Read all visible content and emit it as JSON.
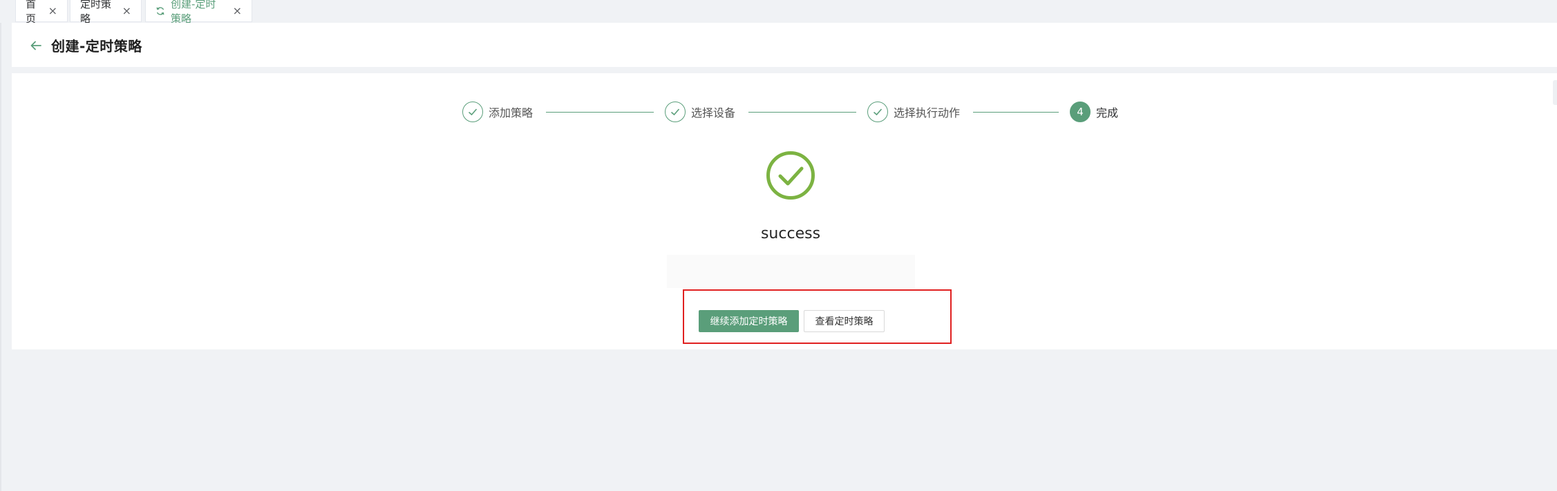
{
  "tabs": [
    {
      "label": "首页"
    },
    {
      "label": "定时策略"
    },
    {
      "label": "创建-定时策略",
      "active": true
    }
  ],
  "header": {
    "title": "创建-定时策略"
  },
  "steps": [
    {
      "label": "添加策略",
      "status": "finished"
    },
    {
      "label": "选择设备",
      "status": "finished"
    },
    {
      "label": "选择执行动作",
      "status": "finished"
    },
    {
      "label": "完成",
      "number": "4",
      "status": "current"
    }
  ],
  "result": {
    "title": "success"
  },
  "actions": {
    "continue_label": "继续添加定时策略",
    "view_label": "查看定时策略"
  },
  "colors": {
    "accent": "#5a9e7a",
    "success_icon": "#7cb342",
    "highlight": "#e02020"
  }
}
